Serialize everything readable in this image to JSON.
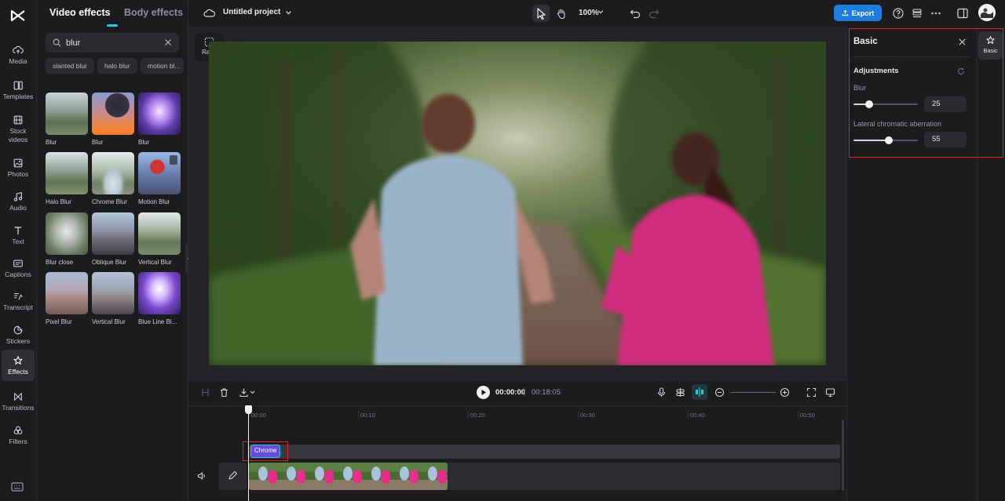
{
  "rail": {
    "items": [
      {
        "label": "Media",
        "icon": "cloud-upload-icon"
      },
      {
        "label": "Templates",
        "icon": "templates-icon"
      },
      {
        "label": "Stock videos",
        "icon": "film-icon"
      },
      {
        "label": "Photos",
        "icon": "photo-icon"
      },
      {
        "label": "Audio",
        "icon": "music-note-icon"
      },
      {
        "label": "Text",
        "icon": "text-t-icon"
      },
      {
        "label": "Captions",
        "icon": "captions-icon"
      },
      {
        "label": "Transcript",
        "icon": "transcript-icon"
      },
      {
        "label": "Stickers",
        "icon": "sticker-icon"
      },
      {
        "label": "Effects",
        "icon": "effects-star-icon",
        "active": true
      },
      {
        "label": "Transitions",
        "icon": "transitions-icon"
      },
      {
        "label": "Filters",
        "icon": "filters-icon"
      }
    ]
  },
  "panel": {
    "tabs": [
      "Video effects",
      "Body effects"
    ],
    "active_tab": "Video effects",
    "search_value": "blur",
    "chips": [
      "slanted blur",
      "halo blur",
      "motion bl..."
    ],
    "effects": [
      {
        "label": "Blur"
      },
      {
        "label": "Blur"
      },
      {
        "label": "Blur"
      },
      {
        "label": "Halo Blur"
      },
      {
        "label": "Chrome Blur"
      },
      {
        "label": "Motion Blur"
      },
      {
        "label": "Blur close"
      },
      {
        "label": "Oblique Blur"
      },
      {
        "label": "Vertical Blur"
      },
      {
        "label": "Pixel Blur"
      },
      {
        "label": "Vertical Blur"
      },
      {
        "label": "Blue Line Bl..."
      }
    ]
  },
  "topbar": {
    "project_title": "Untitled project",
    "zoom": "100%",
    "export_label": "Export"
  },
  "preview": {
    "ratio_label": "Ratio"
  },
  "properties": {
    "title": "Basic",
    "section": "Adjustments",
    "params": [
      {
        "label": "Blur",
        "value": "25",
        "level": 0.25
      },
      {
        "label": "Lateral chromatic aberration",
        "value": "55",
        "level": 0.55
      }
    ],
    "side_tab": "Basic"
  },
  "timeline": {
    "current_time": "00:00:00",
    "total_time": "00:18:05",
    "ruler": [
      "00:00",
      "00:10",
      "00:20",
      "00:30",
      "00:40",
      "00:50"
    ],
    "effect_clip_label": "Chrome"
  },
  "colors": {
    "accent": "#2bc6d8",
    "export": "#1f7ddb",
    "highlight": "#e0262d",
    "effect_clip": "#6a4ad8"
  }
}
